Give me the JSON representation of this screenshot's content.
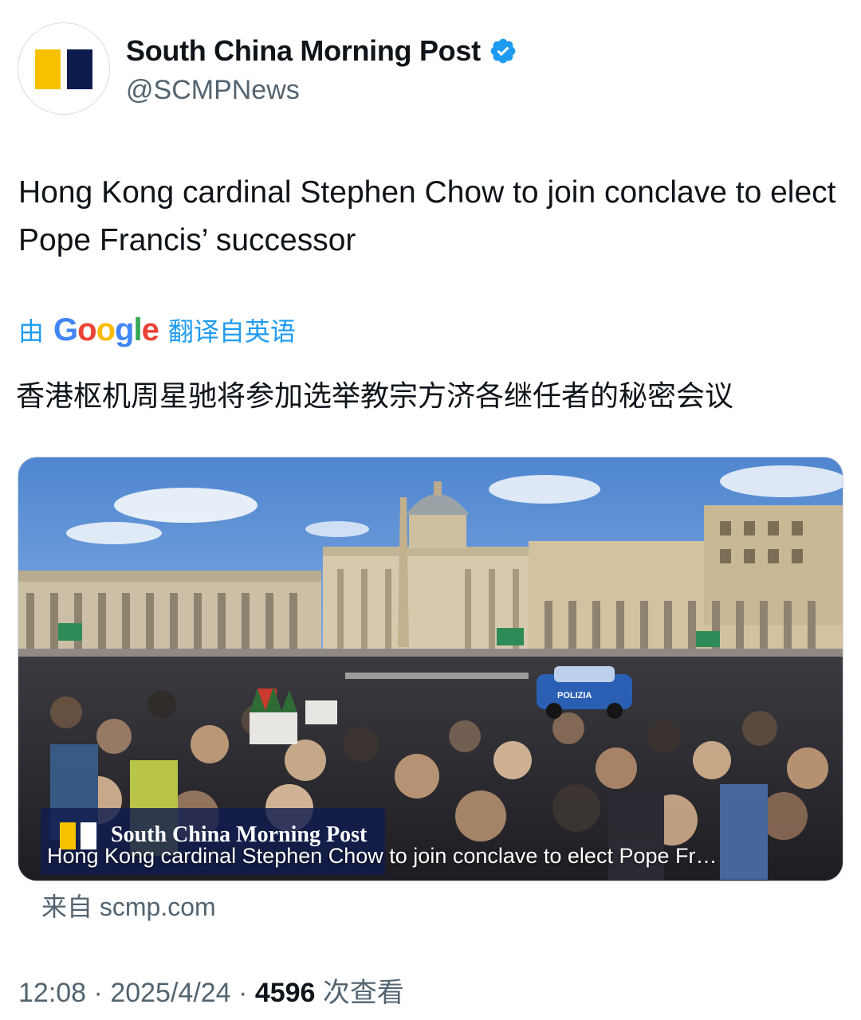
{
  "author": {
    "display_name": "South China Morning Post",
    "handle": "@SCMPNews",
    "verified": true,
    "avatar_icon": "scmp-logo-icon"
  },
  "post": {
    "text": "Hong Kong cardinal Stephen Chow to join conclave to elect Pope Francis’ successor"
  },
  "translation": {
    "prefix": "由",
    "provider": "Google",
    "suffix": "翻译自英语",
    "text": "香港枢机周星驰将参加选举教宗方济各继任者的秘密会议"
  },
  "link_card": {
    "brand_text": "South China Morning Post",
    "caption": "Hong Kong cardinal Stephen Chow to join conclave to elect Pope Fr…",
    "source": "来自 scmp.com",
    "image_sign_text": "POLIZIA"
  },
  "meta": {
    "time": "12:08",
    "date": "2025/4/24",
    "views": "4596",
    "views_label": "次查看",
    "separator": "·"
  },
  "colors": {
    "accent": "#1d9bf0",
    "brand_yellow": "#f6c200",
    "brand_navy": "#0e1b4d",
    "muted_text": "#536471"
  }
}
